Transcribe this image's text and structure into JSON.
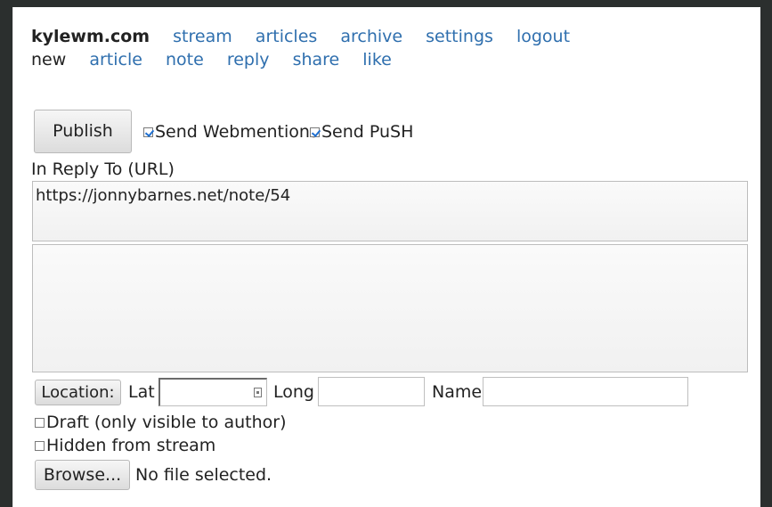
{
  "nav": {
    "site": "kylewm.com",
    "links": [
      "stream",
      "articles",
      "archive",
      "settings",
      "logout"
    ],
    "new_label": "new",
    "new_links": [
      "article",
      "note",
      "reply",
      "share",
      "like"
    ]
  },
  "form": {
    "publish_label": "Publish",
    "send_webmentions_label": "Send Webmentions",
    "send_webmentions_checked": true,
    "send_push_label": "Send PuSH",
    "send_push_checked": true,
    "in_reply_to_label": "In Reply To (URL)",
    "in_reply_to_value": "https://jonnybarnes.net/note/54",
    "content_value": "",
    "location_button": "Location:",
    "lat_label": "Lat",
    "long_label": "Long",
    "name_label": "Name",
    "draft_label": "Draft (only visible to author)",
    "draft_checked": false,
    "hidden_label": "Hidden from stream",
    "hidden_checked": false,
    "browse_label": "Browse...",
    "file_status": "No file selected."
  },
  "colors": {
    "link": "#2f6fae",
    "backdrop": "#2b2f2e",
    "checkmark": "#1e6fd0"
  }
}
